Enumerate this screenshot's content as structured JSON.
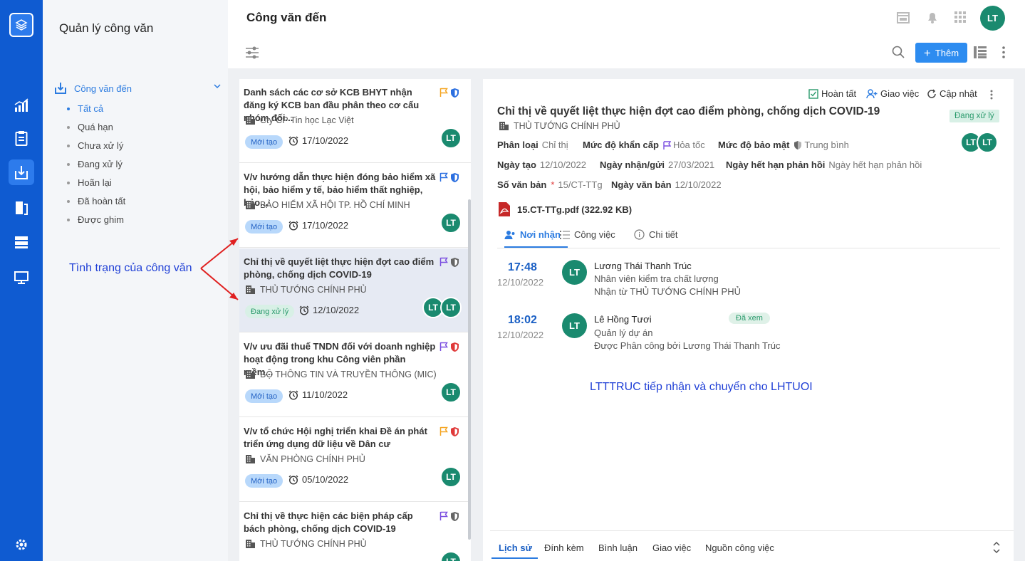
{
  "sidebar": {
    "title": "Quản lý công văn",
    "group_label": "Công văn đến",
    "items": [
      "Tất cả",
      "Quá hạn",
      "Chưa xử lý",
      "Đang xử lý",
      "Hoãn lại",
      "Đã hoàn tất",
      "Được ghim"
    ]
  },
  "header": {
    "title": "Công văn đến",
    "avatar": "LT",
    "add_label": "Thêm"
  },
  "list": [
    {
      "title": "Danh sách các cơ sở KCB BHYT nhận đăng ký KCB ban đầu phân theo cơ cấu nhóm đối...",
      "org": "Cty CP Tin học Lạc Việt",
      "status": "Mới tạo",
      "date": "17/10/2022",
      "avatars": [
        "LT"
      ],
      "flag_color": "#f5a623",
      "shield_color": "#2b6fe0"
    },
    {
      "title": "V/v hướng dẫn thực hiện đóng bảo hiểm xã hội, bảo hiểm y tế, bảo hiểm thất nghiệp, bảo...",
      "org": "BẢO HIỂM XÃ HỘI TP. HỒ CHÍ MINH",
      "status": "Mới tạo",
      "date": "17/10/2022",
      "avatars": [
        "LT"
      ],
      "flag_color": "#2b6fe0",
      "shield_color": "#2b6fe0"
    },
    {
      "title": "Chỉ thị về quyết liệt thực hiện đợt cao điểm phòng, chống dịch COVID-19",
      "org": "THỦ TƯỚNG CHÍNH PHỦ",
      "status": "Đang xử lý",
      "date": "12/10/2022",
      "avatars": [
        "LT",
        "LT"
      ],
      "flag_color": "#7b4fe0",
      "shield_color": "#666666"
    },
    {
      "title": "V/v ưu đãi thuế TNDN đối với doanh nghiệp hoạt động trong khu Công viên phần mềm...",
      "org": "BỘ THÔNG TIN VÀ TRUYỀN THÔNG (MIC)",
      "status": "Mới tạo",
      "date": "11/10/2022",
      "avatars": [
        "LT"
      ],
      "flag_color": "#7b4fe0",
      "shield_color": "#e03a3a"
    },
    {
      "title": "V/v tổ chức Hội nghị triển khai Đề án phát triển ứng dụng dữ liệu về Dân cư",
      "org": "VĂN PHÒNG CHÍNH PHỦ",
      "status": "Mới tạo",
      "date": "05/10/2022",
      "avatars": [
        "LT"
      ],
      "flag_color": "#f5a623",
      "shield_color": "#e03a3a"
    },
    {
      "title": "Chỉ thị về thực hiện các biện pháp cấp bách phòng, chống dịch COVID-19",
      "org": "THỦ TƯỚNG CHÍNH PHỦ",
      "status": "",
      "date": "",
      "avatars": [
        "LT"
      ],
      "flag_color": "#7b4fe0",
      "shield_color": "#666666"
    }
  ],
  "detail": {
    "actions": [
      "Hoàn tất",
      "Giao việc",
      "Cập nhật"
    ],
    "title": "Chỉ thị về quyết liệt thực hiện đợt cao điểm phòng, chống dịch COVID-19",
    "org": "THỦ TƯỚNG CHÍNH PHỦ",
    "status": "Đang xử lý",
    "avatars": [
      "LT",
      "LT"
    ],
    "fields": {
      "phan_loai": {
        "label": "Phân loại",
        "value": "Chỉ thị"
      },
      "khan_cap": {
        "label": "Mức độ khẩn cấp",
        "value": "Hỏa tốc"
      },
      "bao_mat": {
        "label": "Mức độ bảo mật",
        "value": "Trung bình"
      },
      "ngay_tao": {
        "label": "Ngày tạo",
        "value": "12/10/2022"
      },
      "ngay_nhan": {
        "label": "Ngày nhận/gửi",
        "value": "27/03/2021"
      },
      "han_phan_hoi": {
        "label": "Ngày hết hạn phản hồi",
        "value": "Ngày hết hạn phản hồi"
      },
      "so_van_ban": {
        "label": "Số văn bản",
        "value": "15/CT-TTg"
      },
      "ngay_van_ban": {
        "label": "Ngày văn bản",
        "value": "12/10/2022"
      }
    },
    "required_mark": "*",
    "attachment": "15.CT-TTg.pdf (322.92 KB)",
    "tabs": [
      "Nơi nhận",
      "Công việc",
      "Chi tiết"
    ],
    "timeline": [
      {
        "time": "17:48",
        "date": "12/10/2022",
        "avatar": "LT",
        "name": "Lương Thái Thanh Trúc",
        "role": "Nhân viên kiểm tra chất lượng",
        "note": "Nhận từ THỦ TƯỚNG CHÍNH PHỦ"
      },
      {
        "time": "18:02",
        "date": "12/10/2022",
        "avatar": "LT",
        "name": "Lê Hồng Tươi",
        "role": "Quản lý dự án",
        "note": "Được Phân công bởi Lương Thái Thanh Trúc",
        "badge": "Đã xem"
      }
    ],
    "bottom_tabs": [
      "Lịch sử",
      "Đính kèm",
      "Bình luận",
      "Giao việc",
      "Nguồn công việc"
    ]
  },
  "annotations": {
    "left": "Tình trạng của công văn",
    "right": "LTTTRUC tiếp nhận và chuyển cho LHTUOI"
  }
}
